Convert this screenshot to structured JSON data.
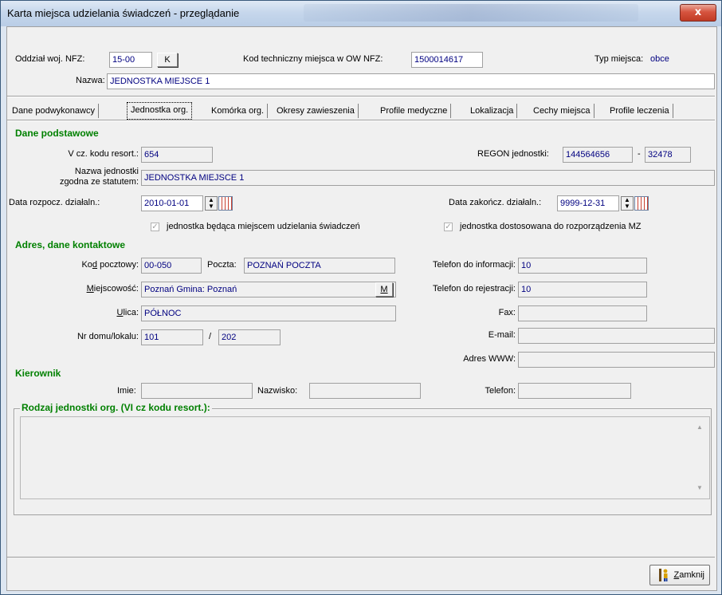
{
  "window": {
    "title": "Karta miejsca udzielania świadczeń - przeglądanie",
    "close_glyph": "x"
  },
  "header": {
    "oddzial_label": "Oddział woj. NFZ:",
    "oddzial_value": "15-00",
    "oddzial_btn": "K",
    "kod_label": "Kod techniczny miejsca w OW NFZ:",
    "kod_value": "1500014617",
    "typ_label": "Typ miejsca:",
    "typ_value": "obce",
    "nazwa_label": "Nazwa:",
    "nazwa_value": "JEDNOSTKA MIEJSCE 1"
  },
  "tabs": [
    {
      "label": "Dane podwykonawcy"
    },
    {
      "label": "Jednostka org."
    },
    {
      "label": "Komórka org."
    },
    {
      "label": "Okresy zawieszenia"
    },
    {
      "label": "Profile medyczne"
    },
    {
      "label": "Lokalizacja"
    },
    {
      "label": "Cechy miejsca"
    },
    {
      "label": "Profile leczenia"
    }
  ],
  "basic": {
    "section": "Dane podstawowe",
    "vcz_label": "V cz. kodu resort.:",
    "vcz_value": "654",
    "regon_label": "REGON jednostki:",
    "regon_value": "144564656",
    "regon_dash": "-",
    "regon_suffix": "32478",
    "nazwa_label_1": "Nazwa jednostki",
    "nazwa_label_2": "zgodna ze statutem:",
    "nazwa_value": "JEDNOSTKA MIEJSCE 1",
    "start_label": "Data rozpocz. działaln.:",
    "start_value": "2010-01-01",
    "end_label": "Data zakończ. działaln.:",
    "end_value": "9999-12-31",
    "chk1_label": "jednostka będąca miejscem udzielania świadczeń",
    "chk2_label": "jednostka dostosowana do rozporządzenia MZ",
    "checked_glyph": "✓"
  },
  "address": {
    "section": "Adres, dane kontaktowe",
    "kod_label_pre": "Ko",
    "kod_label_u": "d",
    "kod_label_post": " pocztowy:",
    "kod_value": "00-050",
    "poczta_label": "Poczta:",
    "poczta_value": "POZNAŃ POCZTA",
    "miejsc_label_u": "M",
    "miejsc_label_post": "iejscowość:",
    "miejsc_value": "Poznań Gmina: Poznań",
    "miejsc_btn": "M",
    "ulica_label_u": "U",
    "ulica_label_post": "lica:",
    "ulica_value": "PÓŁNOC",
    "nr_label": "Nr domu/lokalu:",
    "nr_dom": "101",
    "nr_slash": "/",
    "nr_lok": "202",
    "tel_info_label": "Telefon do informacji:",
    "tel_info_value": "10",
    "tel_rej_label": "Telefon do rejestracji:",
    "tel_rej_value": "10",
    "fax_label": "Fax:",
    "fax_value": "",
    "email_label": "E-mail:",
    "email_value": "",
    "www_label": "Adres WWW:",
    "www_value": ""
  },
  "manager": {
    "section": "Kierownik",
    "imie_label": "Imie:",
    "imie_value": "",
    "nazwisko_label": "Nazwisko:",
    "nazwisko_value": "",
    "telefon_label": "Telefon:",
    "telefon_value": ""
  },
  "rodzaj": {
    "title": "Rodzaj jednostki org. (VI cz kodu resort.):",
    "value": "",
    "scroll_up": "▲",
    "scroll_down": "▼"
  },
  "footer": {
    "close_u": "Z",
    "close_post": "amknij"
  },
  "colors": {
    "section_green": "#008000",
    "value_blue": "#000080",
    "title_close_red": "#c03a24"
  },
  "icons": [
    "close-icon",
    "spin-icon",
    "calendar-icon",
    "checkbox-icon",
    "person-exit-icon"
  ]
}
